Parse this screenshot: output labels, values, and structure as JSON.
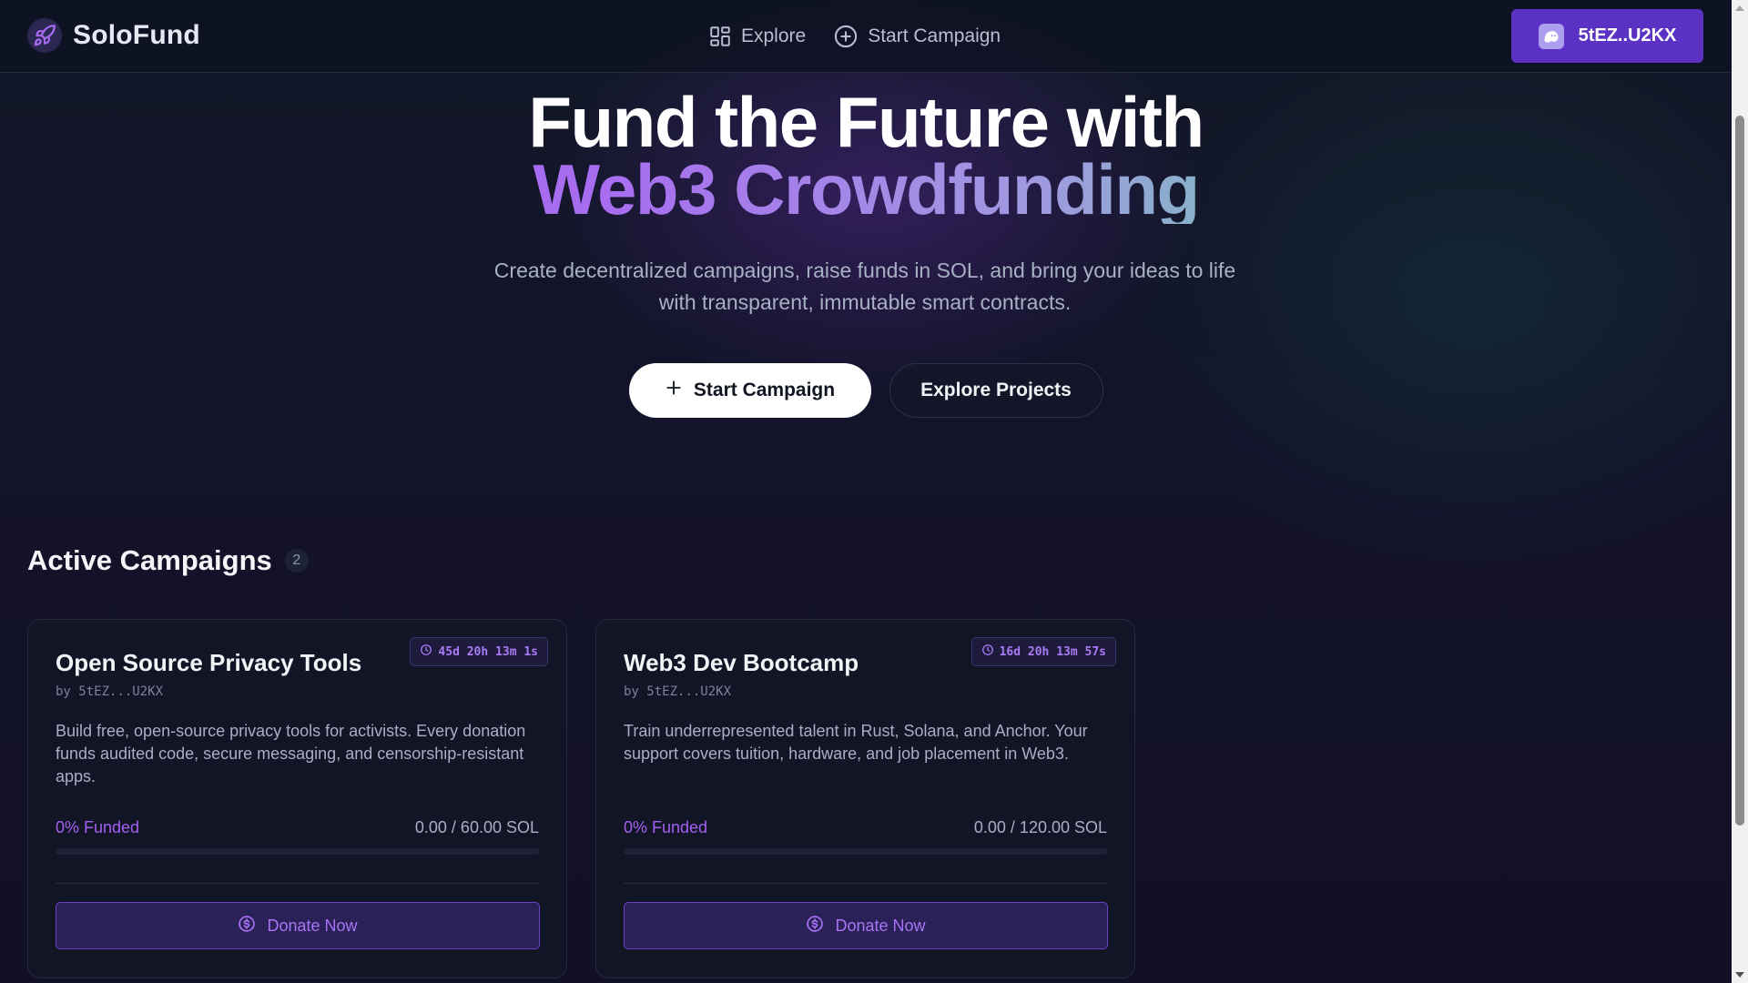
{
  "brand": {
    "name": "SoloFund",
    "icon": "rocket-icon"
  },
  "nav": {
    "items": [
      {
        "label": "Explore",
        "icon": "grid-icon"
      },
      {
        "label": "Start Campaign",
        "icon": "plus-circle-icon"
      }
    ]
  },
  "wallet": {
    "label": "5tEZ..U2KX",
    "icon": "phantom-ghost-icon"
  },
  "hero": {
    "title_line1": "Fund the Future with",
    "title_line2": "Web3 Crowdfunding",
    "subtitle": "Create decentralized campaigns, raise funds in SOL, and bring your ideas to life with transparent, immutable smart contracts.",
    "primary_cta": "Start Campaign",
    "secondary_cta": "Explore Projects"
  },
  "campaigns_section": {
    "title": "Active Campaigns",
    "count": "2",
    "campaigns": [
      {
        "title": "Open Source Privacy Tools",
        "by": "by 5tEZ...U2KX",
        "time_left": "45d 20h 13m 1s",
        "description": "Build free, open-source privacy tools for activists. Every donation funds audited code, secure messaging, and censorship-resistant apps.",
        "funded_label": "0% Funded",
        "funded_fraction": 0,
        "goal_text": "0.00 / 60.00 SOL",
        "donate_label": "Donate Now"
      },
      {
        "title": "Web3 Dev Bootcamp",
        "by": "by 5tEZ...U2KX",
        "time_left": "16d 20h 13m 57s",
        "description": "Train underrepresented talent in Rust, Solana, and Anchor. Your support covers tuition, hardware, and job placement in Web3.",
        "funded_label": "0% Funded",
        "funded_fraction": 0,
        "goal_text": "0.00 / 120.00 SOL",
        "donate_label": "Donate Now"
      }
    ]
  },
  "colors": {
    "accent": "#5b32c4",
    "accent_text": "#a360f0",
    "gradient_start": "#9b5cf5",
    "gradient_end": "#22e59a",
    "background": "#0d1224"
  }
}
